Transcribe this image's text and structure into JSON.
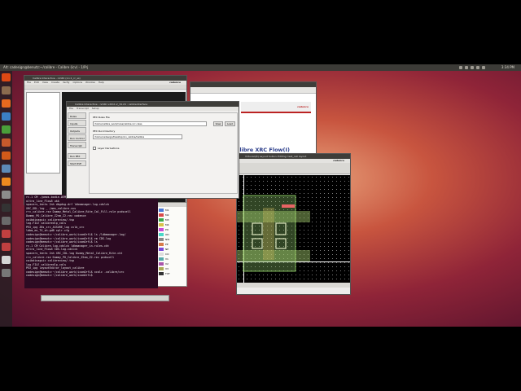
{
  "topbar": {
    "title": "Alt: cadesign@benutz:~/calibre - Calibre (icv) - 1/Prj",
    "clock": "3:34 PM"
  },
  "launcher": {
    "icons": [
      "ubuntu-icon",
      "files-icon",
      "firefox-icon",
      "libreoffice-writer-icon",
      "libreoffice-calc-icon",
      "libreoffice-impress-icon",
      "software-center-icon",
      "ubuntu-one-icon",
      "amazon-icon",
      "settings-icon",
      "terminal-icon",
      "workspace-icon",
      "app-icon",
      "app-icon",
      "app-icon",
      "trash-icon"
    ]
  },
  "cad_window": {
    "title": "Calibre Interactive - nmRC (icv:1_rc_ss)",
    "menus": [
      "File",
      "Edit",
      "View",
      "Create",
      "Verify",
      "Options",
      "Window",
      "Help"
    ],
    "brand": "cadence"
  },
  "calibre_dialog": {
    "title": "Calibre Interactive - nmRC v2011.2_34.24 : calibreinterface",
    "menus": [
      "File",
      "Transcript",
      "Setup"
    ],
    "side_buttons": [
      "Rules",
      "Inputs",
      "Outputs",
      "Run Control",
      "Transcript"
    ],
    "fields": {
      "rules_file_label": "PEX Rules File",
      "rules_file": "/home/calibre_work/rules/calibre.xrc.rules",
      "runset_label": "PEX Run Directory",
      "rundir": "/home/cadesign/Desktop/icv_calibre/Calibre"
    },
    "buttons": {
      "view": "View",
      "load": "Load"
    },
    "check_label": "Layer Derivations",
    "run_buttons": [
      "Run PEX",
      "Start RVE"
    ]
  },
  "browser": {
    "heading": "alibre XRC Flow(I)",
    "brand": "cadence"
  },
  "layout_window": {
    "title": "Virtuoso(R) Layout Suite L Editing: test_cell layout",
    "brand": "cadence"
  },
  "terminal": {
    "lines": [
      "rc.1 CM    ./pmos.bodie-DEMO",
      "ultra_line_Flow5   ukk   ",
      "spacers_tents 2nh  dbgdsg.drf       ldbmanager.log.cdslck",
      "                   XRC_GDL.log      _ /ams_calibre.svu",
      "rrc_calibre.rse    Dummy_Metal_Calibre_Rite_Cal_Fill.rule  pcdscell",
      "                   Dummy_PO_Calibre_Z2nm_Z2.rec            cadence",
      "caibdinaguic       calibreview/.tsp",
      "log.FILE           calibredlp_cals",
      "PEX_ipg            Z6s_xrc_ASSURE_log     cvlb_xrc",
      "                   ldbm_ee_TV_sh.gdB       xplr.cfg",
      "cadesign@bemutz:~/calibre_work/icomOrfL$ ls /ldbmanager.log/",
      "cadesign@bemutz:~/calibre_work/icomOrfL$ rm CDS.log",
      "cadesign@bemutz:~/calibre_work/icomOrfL$ ls",
      "rc.1 CM  Calibre.log.cdslck        ldbmanager_in.rules.ckt",
      "ultra_line_Flow5       CDS.log.cdslck",
      "spacers_tents 2nh  XRC_CDL.log     Dummy_Metal_Calibre_Rite.ckt",
      "rrc_calibre.rse    Dummy_PO_Calibre_Z2nm_Z2.rec    pcdscell",
      "caibdinaguic       calibreview/.tsp",
      "log.FILE           calibredlp_cals",
      "PEX_ipg            layoutEditor_layout_calibre",
      "cadesign@bemutz:~/calibre_work/icomOrfL$ xcalc -calibre/xrc",
      "cadesign@bemutz:~/calibre_work/icomOrfL$ "
    ]
  },
  "palette": {
    "rows": [
      "M1",
      "M2",
      "M3",
      "M4",
      "PO",
      "OD",
      "NW",
      "PP",
      "NP",
      "CO",
      "V1",
      "V2",
      "V3",
      "TXT"
    ]
  }
}
